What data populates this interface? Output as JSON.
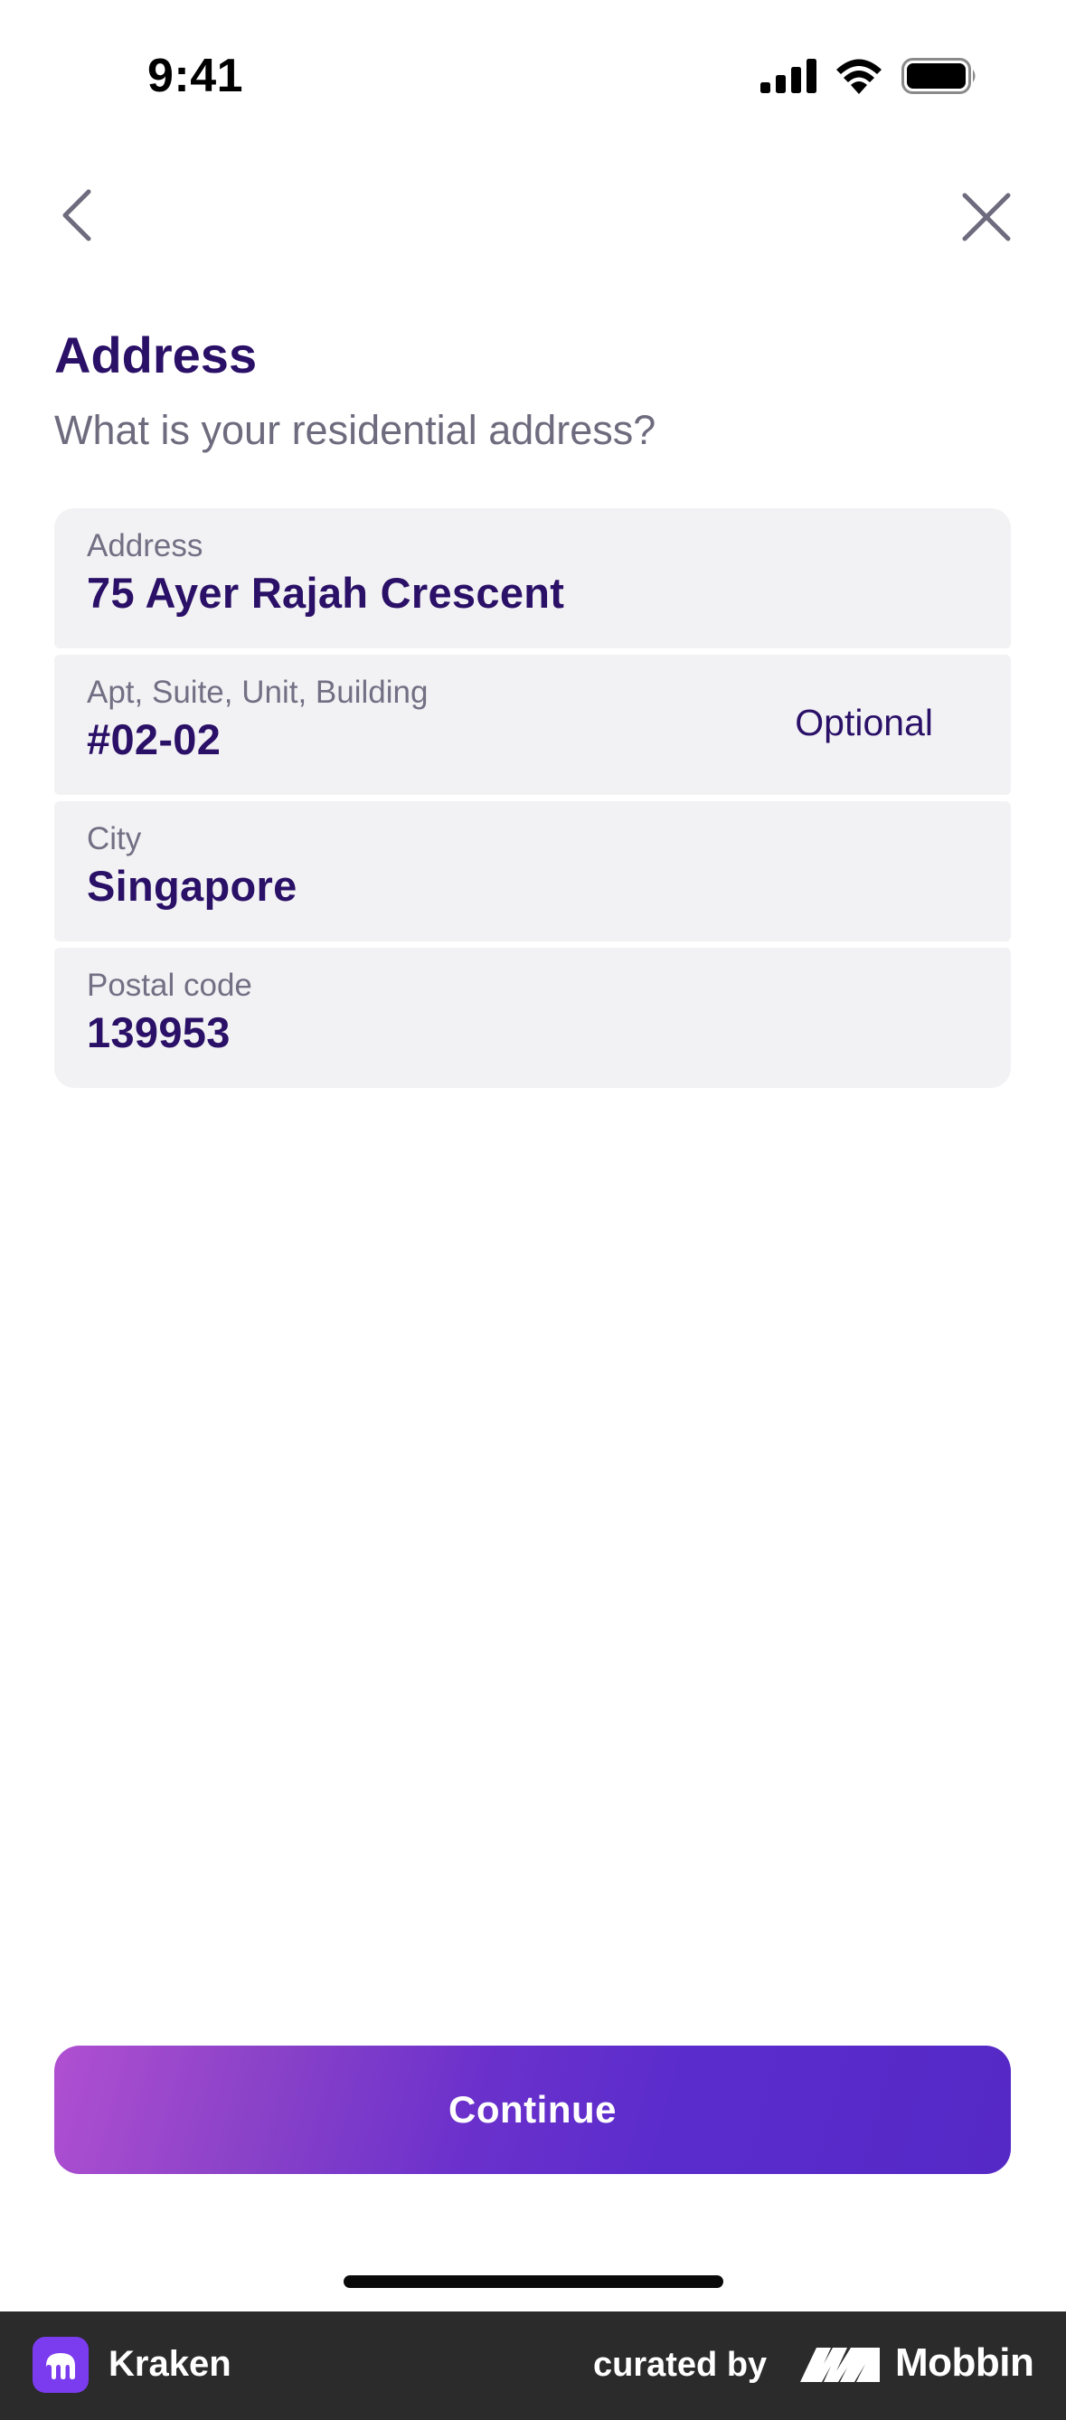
{
  "status_bar": {
    "time": "9:41",
    "signal_icon": "cellular-signal-icon",
    "wifi_icon": "wifi-icon",
    "battery_icon": "battery-icon"
  },
  "nav": {
    "back_icon": "chevron-left-icon",
    "close_icon": "close-icon"
  },
  "header": {
    "title": "Address",
    "subtitle": "What is your residential address?"
  },
  "form": {
    "fields": [
      {
        "label": "Address",
        "value": "75 Ayer Rajah Crescent"
      },
      {
        "label": "Apt, Suite, Unit, Building",
        "value": "#02-02",
        "hint": "Optional"
      },
      {
        "label": "City",
        "value": "Singapore"
      },
      {
        "label": "Postal code",
        "value": "139953"
      }
    ]
  },
  "actions": {
    "continue_label": "Continue"
  },
  "footer": {
    "app_name": "Kraken",
    "curated_by": "curated by",
    "brand": "Mobbin"
  },
  "colors": {
    "title": "#2a1067",
    "field_background": "#f2f2f4",
    "button_gradient_start": "#b04fd1",
    "button_gradient_end": "#5529c6",
    "footer_background": "#2b2b2b"
  }
}
